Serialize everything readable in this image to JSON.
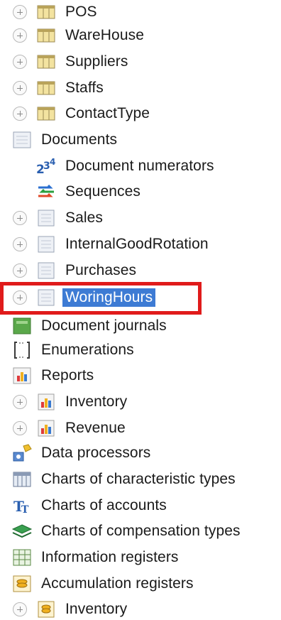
{
  "tree": {
    "catalogs": [
      {
        "label": "POS"
      },
      {
        "label": "WareHouse"
      },
      {
        "label": "Suppliers"
      },
      {
        "label": "Staffs"
      },
      {
        "label": "ContactType"
      }
    ],
    "documents": {
      "label": "Documents",
      "numerators": "Document numerators",
      "sequences": "Sequences",
      "items": [
        {
          "label": "Sales"
        },
        {
          "label": "InternalGoodRotation"
        },
        {
          "label": "Purchases"
        },
        {
          "label": "WoringHours",
          "selected": true
        }
      ]
    },
    "document_journals": "Document journals",
    "enumerations": "Enumerations",
    "reports": {
      "label": "Reports",
      "items": [
        {
          "label": "Inventory"
        },
        {
          "label": "Revenue"
        }
      ]
    },
    "data_processors": "Data processors",
    "charts_char_types": "Charts of characteristic types",
    "charts_accounts": "Charts of accounts",
    "charts_comp_types": "Charts of compensation types",
    "information_registers": "Information registers",
    "accumulation_registers": {
      "label": "Accumulation registers",
      "items": [
        {
          "label": "Inventory"
        }
      ]
    }
  },
  "colors": {
    "selection": "#3d7bd4",
    "highlight_frame": "#e01b1b"
  }
}
